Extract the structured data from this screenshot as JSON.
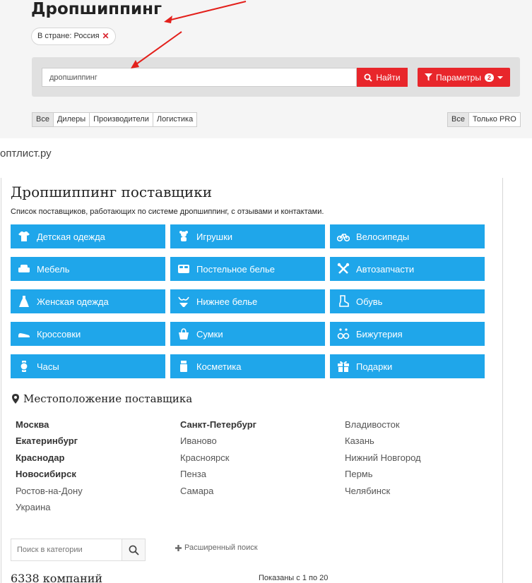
{
  "top": {
    "title": "Дропшиппинг",
    "chip_label": "В стране: Россия",
    "chip_remove": "✕",
    "search_value": "дропшиппинг",
    "find_label": "Найти",
    "params_label": "Параметры",
    "params_count": "2",
    "type_filters": [
      {
        "label": "Все",
        "active": true
      },
      {
        "label": "Дилеры",
        "active": false
      },
      {
        "label": "Производители",
        "active": false
      },
      {
        "label": "Логистика",
        "active": false
      }
    ],
    "pro_filters": [
      {
        "label": "Все",
        "active": true
      },
      {
        "label": "Только PRO",
        "active": false
      }
    ]
  },
  "site_name": "оптлист.ру",
  "main": {
    "title": "Дропшиппинг поставщики",
    "subtitle": "Список поставщиков, работающих по системе дропшиппинг, с отзывами и контактами.",
    "categories": [
      {
        "label": "Детская одежда",
        "icon": "baby-clothes-icon"
      },
      {
        "label": "Игрушки",
        "icon": "toy-icon"
      },
      {
        "label": "Велосипеды",
        "icon": "bicycle-icon"
      },
      {
        "label": "Мебель",
        "icon": "armchair-icon"
      },
      {
        "label": "Постельное белье",
        "icon": "bed-icon"
      },
      {
        "label": "Автозапчасти",
        "icon": "wrench-icon"
      },
      {
        "label": "Женская одежда",
        "icon": "dress-icon"
      },
      {
        "label": "Нижнее белье",
        "icon": "lingerie-icon"
      },
      {
        "label": "Обувь",
        "icon": "boot-icon"
      },
      {
        "label": "Кроссовки",
        "icon": "sneaker-icon"
      },
      {
        "label": "Сумки",
        "icon": "bag-icon"
      },
      {
        "label": "Бижутерия",
        "icon": "earrings-icon"
      },
      {
        "label": "Часы",
        "icon": "watch-icon"
      },
      {
        "label": "Косметика",
        "icon": "cosmetics-icon"
      },
      {
        "label": "Подарки",
        "icon": "gift-icon"
      }
    ],
    "location_title": "Местоположение поставщика",
    "cities": [
      {
        "label": "Москва",
        "bold": true
      },
      {
        "label": "Санкт-Петербург",
        "bold": true
      },
      {
        "label": "Владивосток",
        "bold": false
      },
      {
        "label": "Екатеринбург",
        "bold": true
      },
      {
        "label": "Иваново",
        "bold": false
      },
      {
        "label": "Казань",
        "bold": false
      },
      {
        "label": "Краснодар",
        "bold": true
      },
      {
        "label": "Красноярск",
        "bold": false
      },
      {
        "label": "Нижний Новгород",
        "bold": false
      },
      {
        "label": "Новосибирск",
        "bold": true
      },
      {
        "label": "Пенза",
        "bold": false
      },
      {
        "label": "Пермь",
        "bold": false
      },
      {
        "label": "Ростов-на-Дону",
        "bold": false
      },
      {
        "label": "Самара",
        "bold": false
      },
      {
        "label": "Челябинск",
        "bold": false
      },
      {
        "label": "Украина",
        "bold": false
      }
    ],
    "category_search_placeholder": "Поиск в категории",
    "advanced_search": "Расширенный поиск",
    "company_count": "6338 компаний",
    "shown_range": "Показаны с 1 по 20"
  },
  "colors": {
    "accent_red": "#e8262b",
    "category_blue": "#1fa6ea",
    "arrow_red": "#e3201b"
  }
}
